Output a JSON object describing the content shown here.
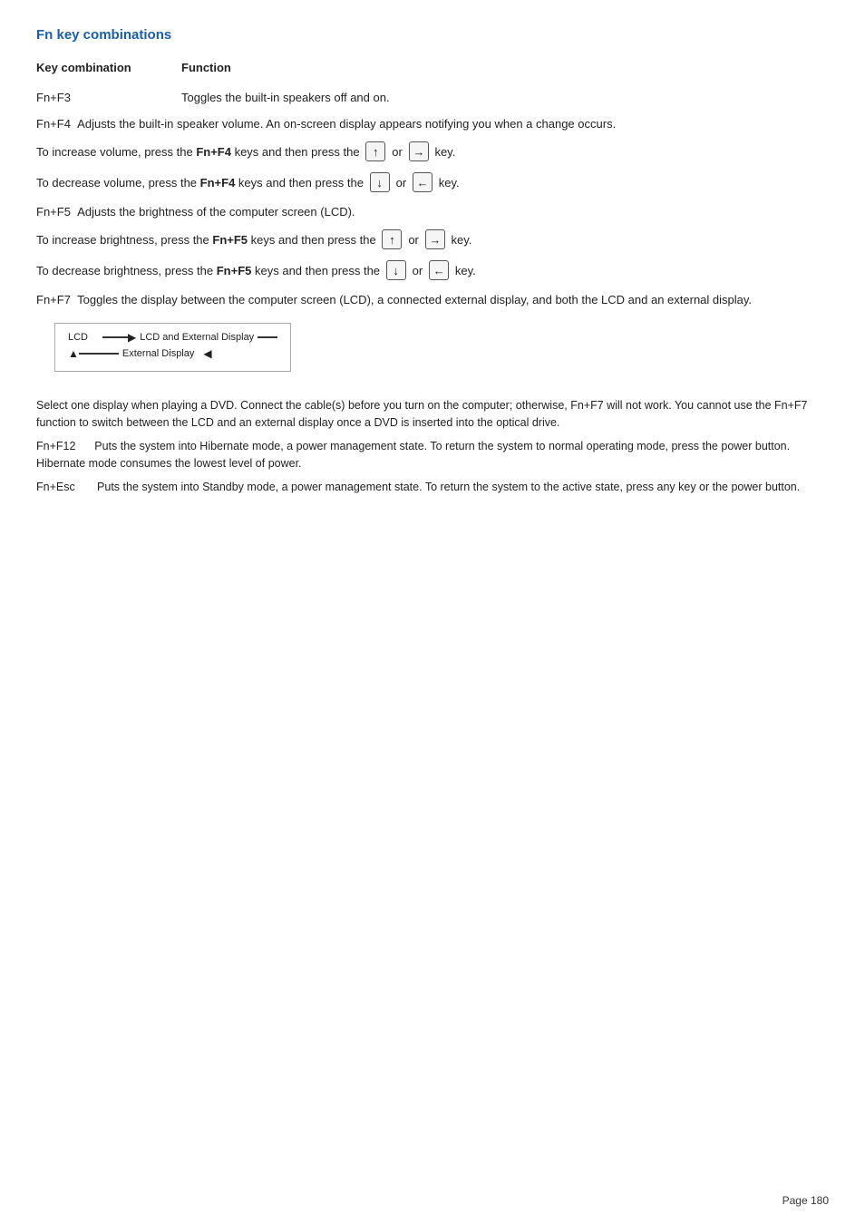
{
  "page": {
    "title": "Fn key combinations",
    "header": {
      "key_combination": "Key combination",
      "function": "Function"
    },
    "fn_f3": {
      "key": "Fn+F3",
      "description": "Toggles the built-in speakers off and on."
    },
    "fn_f4": {
      "key": "Fn+F4",
      "description": "Adjusts the built-in speaker volume. An on-screen display appears notifying you when a change occurs.",
      "increase": {
        "text_before": "To increase volume, press the ",
        "bold": "Fn+F4",
        "text_after": " keys and then press the",
        "keys": [
          "↑",
          "→"
        ],
        "text_end": "key."
      },
      "decrease": {
        "text_before": "To decrease volume, press the ",
        "bold": "Fn+F4",
        "text_after": " keys and then press the",
        "keys": [
          "↓",
          "←"
        ],
        "text_end": "key."
      }
    },
    "fn_f5": {
      "key": "Fn+F5",
      "description": "Adjusts the brightness of the computer screen (LCD).",
      "increase": {
        "text_before": "To increase brightness, press the ",
        "bold": "Fn+F5",
        "text_after": " keys and then press the",
        "keys": [
          "↑",
          "→"
        ],
        "text_end": "key."
      },
      "decrease": {
        "text_before": "To decrease brightness, press the ",
        "bold": "Fn+F5",
        "text_after": " keys and then press the",
        "keys": [
          "↓",
          "←"
        ],
        "text_end": "key."
      }
    },
    "fn_f7": {
      "key": "Fn+F7",
      "description": "Toggles the display between the computer screen (LCD), a connected external display, and both the LCD and an external display.",
      "diagram": {
        "lcd_label": "LCD",
        "lcd_and_ext": "LCD and External Display",
        "ext_display": "External Display"
      }
    },
    "select_dvd": "Select one display when playing a DVD. Connect the cable(s) before you turn on the computer; otherwise, Fn+F7 will not work. You cannot use the Fn+F7 function to switch between the LCD and an external display once a DVD is inserted into the optical drive.",
    "fn_f12": {
      "key": "Fn+F12",
      "description": "Puts the system into Hibernate mode, a power management state. To return the system to normal operating mode, press the power button. Hibernate mode consumes the lowest level of power."
    },
    "fn_esc": {
      "key": "Fn+Esc",
      "description": "Puts the system into Standby mode, a power management state. To return the system to the active state, press any key or the power button."
    },
    "page_number": "Page 180"
  }
}
